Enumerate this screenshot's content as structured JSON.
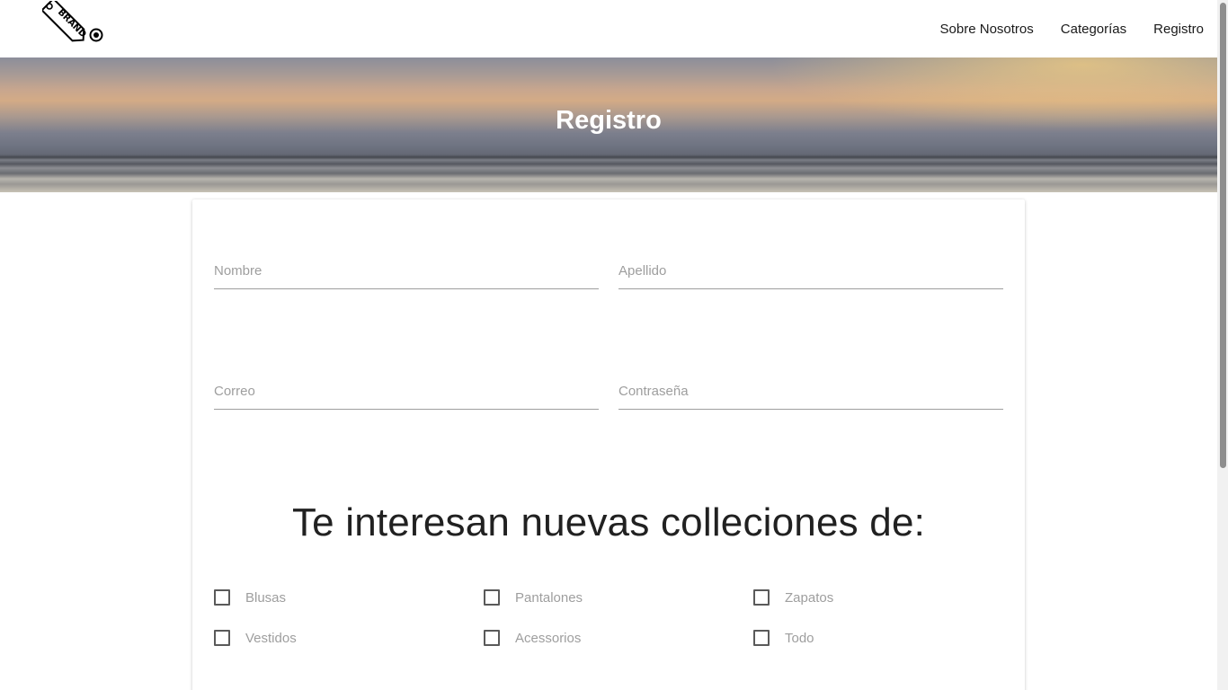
{
  "navbar": {
    "brand_text": "BRAND",
    "links": [
      "Sobre Nosotros",
      "Categorías",
      "Registro"
    ]
  },
  "hero": {
    "title": "Registro"
  },
  "form": {
    "fields": {
      "nombre": {
        "placeholder": "Nombre",
        "value": ""
      },
      "apellido": {
        "placeholder": "Apellido",
        "value": ""
      },
      "correo": {
        "placeholder": "Correo",
        "value": ""
      },
      "contrasena": {
        "placeholder": "Contraseña",
        "value": ""
      }
    },
    "interests_title": "Te interesan nuevas colleciones de:",
    "checkboxes": [
      "Blusas",
      "Pantalones",
      "Zapatos",
      "Vestidos",
      "Acessorios",
      "Todo"
    ]
  }
}
